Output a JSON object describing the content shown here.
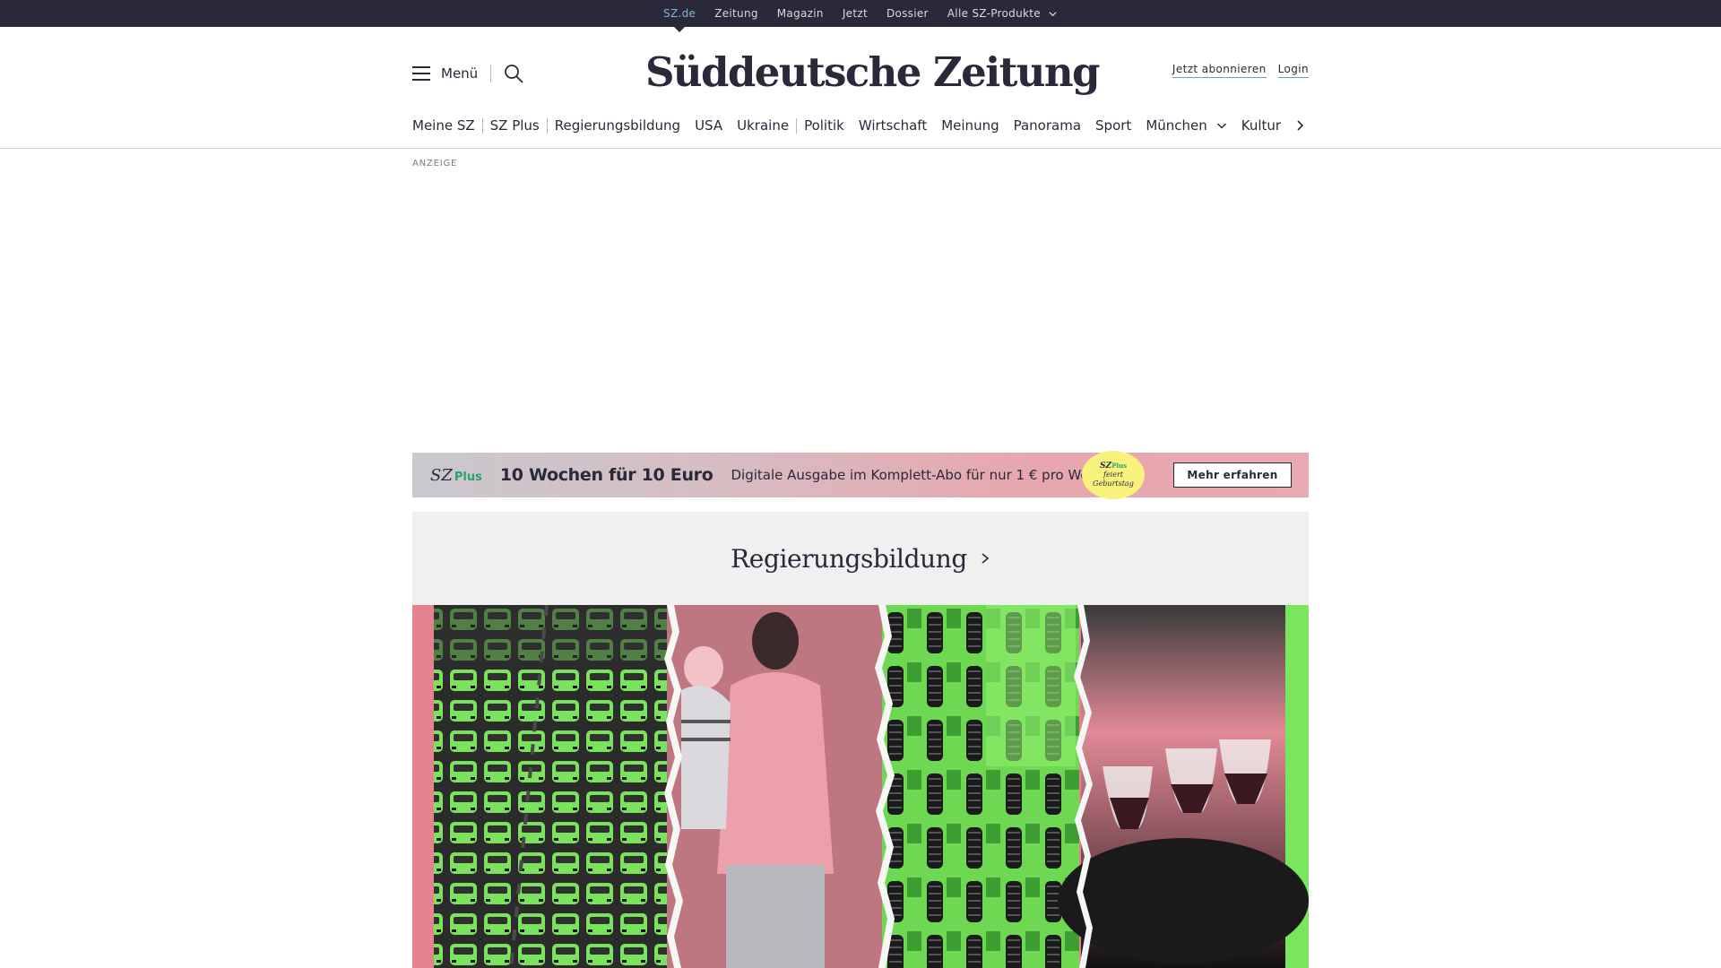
{
  "topbar": {
    "links": [
      "SZ.de",
      "Zeitung",
      "Magazin",
      "Jetzt",
      "Dossier",
      "Alle SZ-Produkte"
    ]
  },
  "header": {
    "menu_label": "Menü",
    "logo_text": "Süddeutsche Zeitung",
    "subscribe_label": "Jetzt abonnieren",
    "login_label": "Login"
  },
  "nav": {
    "items": [
      "Meine SZ",
      "SZ Plus",
      "Regierungsbildung",
      "USA",
      "Ukraine",
      "Politik",
      "Wirtschaft",
      "Meinung",
      "Panorama",
      "Sport",
      "München",
      "Kultur"
    ]
  },
  "ad": {
    "label": "ANZEIGE"
  },
  "promo": {
    "logo_sz": "SZ",
    "logo_plus": "Plus",
    "headline": "10 Wochen für 10 Euro",
    "text": "Digitale Ausgabe im Komplett-Abo für nur 1 € pro Woche.",
    "badge_line1": "SZ",
    "badge_line1_plus": "Plus",
    "badge_line2": "feiert",
    "badge_line3": "Geburtstag",
    "button_label": "Mehr erfahren"
  },
  "topic": {
    "title": "Regierungsbildung"
  },
  "collage": {
    "panels": [
      "traffic-jam",
      "woman-carrying-child",
      "tractors",
      "wine-glasses"
    ],
    "colors": {
      "pink": "#e4828f",
      "green": "#7ae55e",
      "dark": "#1e1e22"
    }
  },
  "colors": {
    "topbar_bg": "#29293a",
    "topbar_active": "#7fb6d1",
    "text": "#29293a",
    "link_underline": "#5aa6c8",
    "badge_yellow": "#f8f37d",
    "plus_green": "#2aa36a"
  }
}
